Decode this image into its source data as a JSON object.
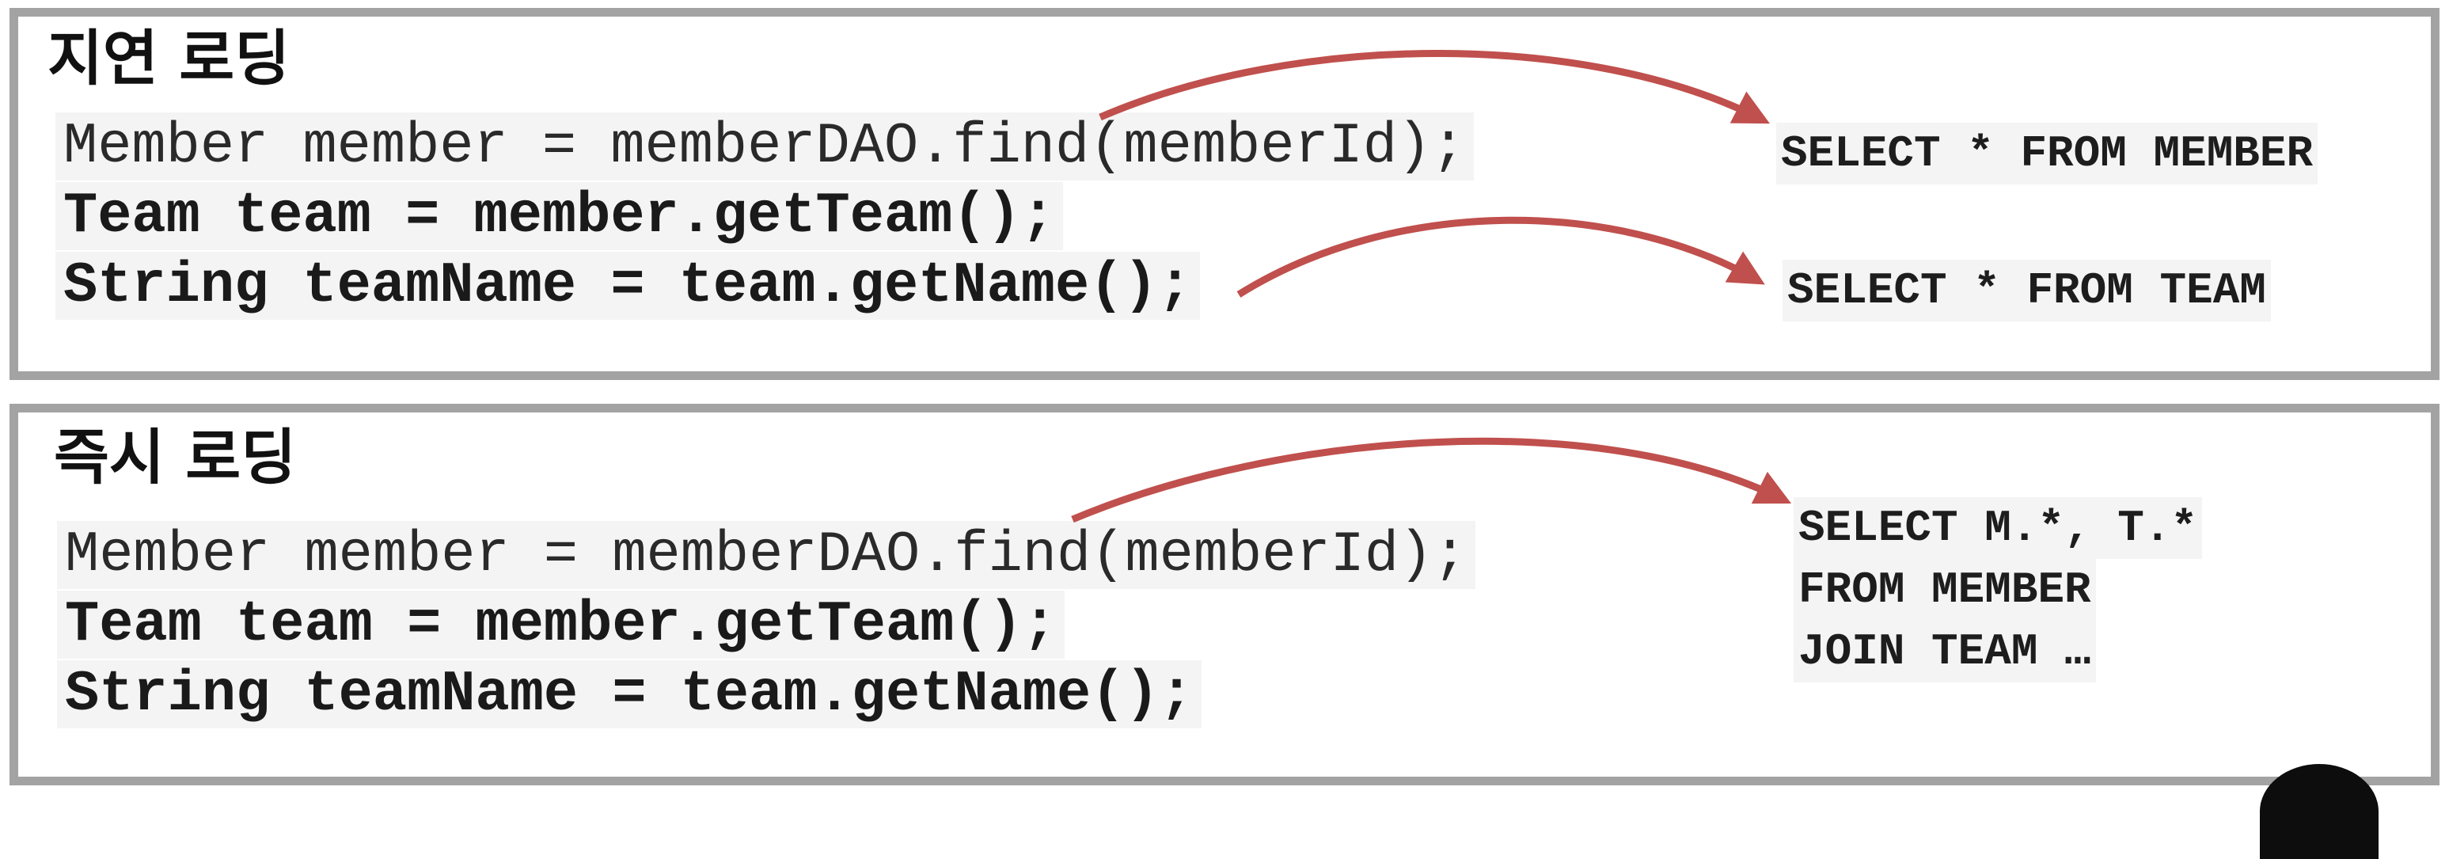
{
  "lazy": {
    "title": "지연 로딩",
    "code": [
      "Member member = memberDAO.find(memberId);",
      "Team team = member.getTeam();",
      "String teamName = team.getName();"
    ],
    "sql": [
      "SELECT * FROM MEMBER",
      "SELECT * FROM TEAM"
    ]
  },
  "eager": {
    "title": "즉시 로딩",
    "code": [
      "Member member = memberDAO.find(memberId);",
      "Team team = member.getTeam();",
      "String teamName = team.getName();"
    ],
    "sql": [
      "SELECT M.*, T.*",
      "FROM MEMBER",
      "JOIN TEAM …"
    ]
  },
  "colors": {
    "arrow": "#c0504d",
    "border": "#a3a3a3",
    "code_bg": "#f4f4f4"
  }
}
